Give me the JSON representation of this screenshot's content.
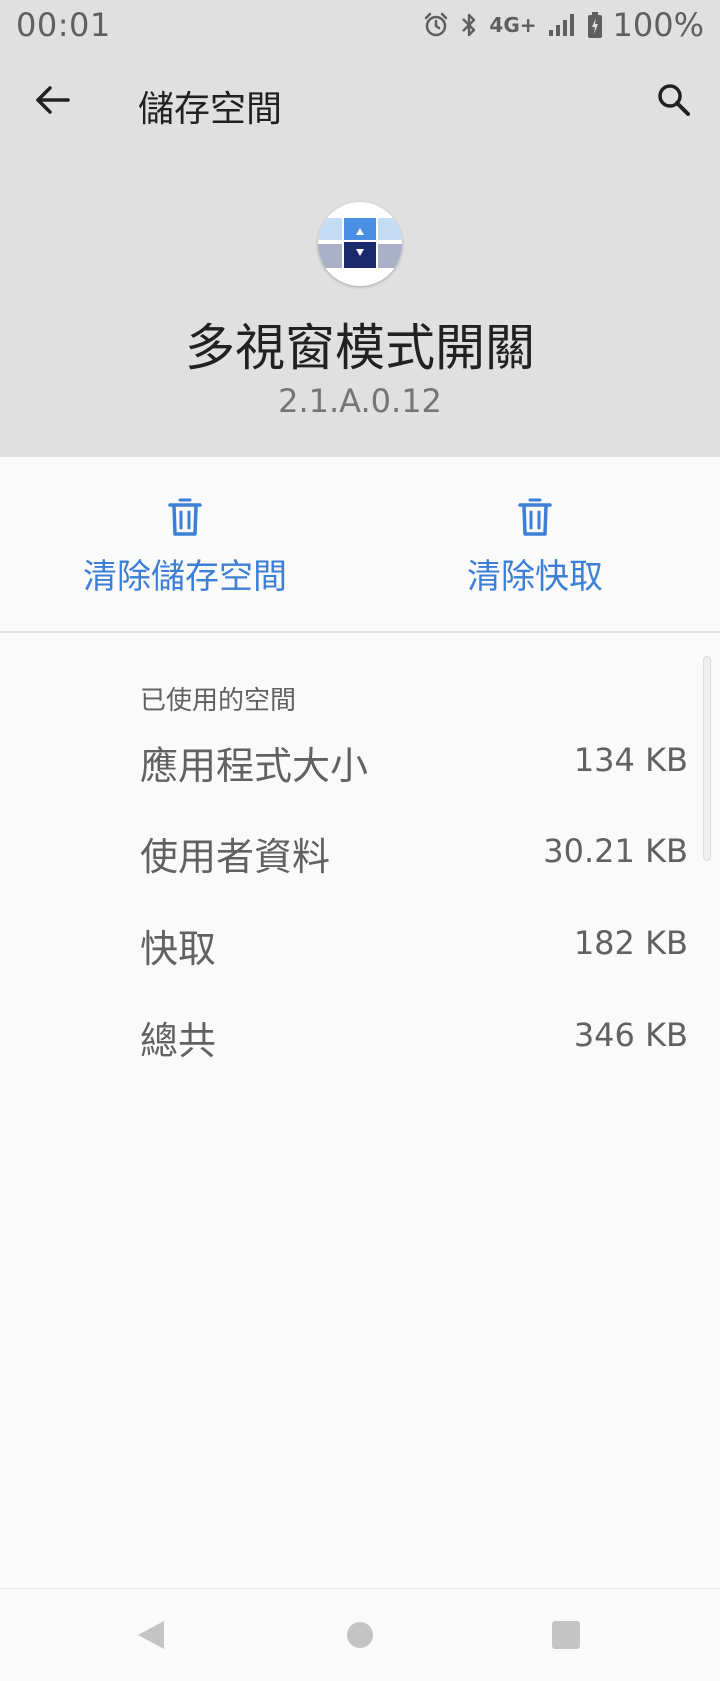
{
  "status_bar": {
    "time": "00:01",
    "network": "4G+",
    "battery": "100%",
    "icons": [
      "alarm-icon",
      "bluetooth-icon",
      "signal-icon",
      "battery-icon"
    ]
  },
  "toolbar": {
    "title": "儲存空間",
    "back_icon": "arrow-back-icon",
    "search_icon": "search-icon"
  },
  "app": {
    "name": "多視窗模式開關",
    "version": "2.1.A.0.12",
    "icon": "multi-window-switch-icon"
  },
  "actions": {
    "clear_storage": "清除儲存空間",
    "clear_cache": "清除快取",
    "icon": "trash-icon"
  },
  "storage": {
    "section_title": "已使用的空間",
    "rows": [
      {
        "label": "應用程式大小",
        "value": "134 KB"
      },
      {
        "label": "使用者資料",
        "value": "30.21 KB"
      },
      {
        "label": "快取",
        "value": "182 KB"
      },
      {
        "label": "總共",
        "value": "346 KB"
      }
    ]
  },
  "nav_bar": {
    "icons": [
      "back-triangle-icon",
      "home-circle-icon",
      "recents-square-icon"
    ]
  },
  "colors": {
    "header_bg": "#e0e0e0",
    "accent": "#3d7fd6",
    "body_bg": "#fafafa"
  }
}
